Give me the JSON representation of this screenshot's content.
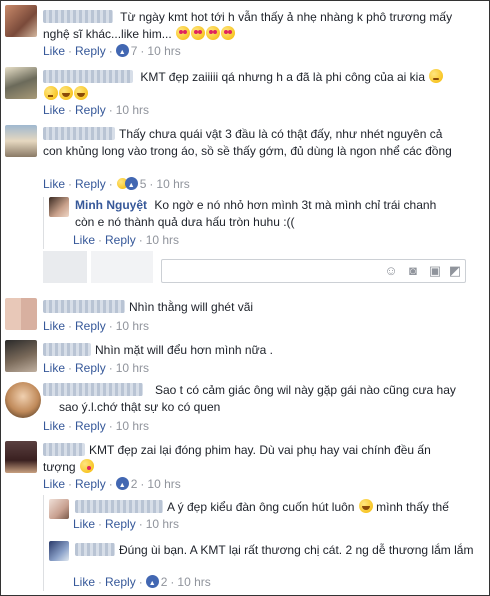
{
  "labels": {
    "like": "Like",
    "reply": "Reply",
    "dot": "·"
  },
  "comments": [
    {
      "text": "Từ ngày kmt hot tới h vẫn thấy ả nhẹ nhàng k phô trương mấy nghệ sĩ khác...like him...",
      "reactions": "like",
      "count": "7",
      "time": "10 hrs"
    },
    {
      "text": "KMT đẹp zaiiiii qá nhưng h a đã là phi công của ai kia",
      "reactions": "",
      "count": "",
      "time": "10 hrs"
    },
    {
      "text": "Thấy chưa quái vật 3 đầu là có thật đấy, như nhét nguyên cả con khủng long vào trong áo, sồ sề thấy gớm, đủ dùng là ngon nhể các đồng",
      "reactions": "haha-like",
      "count": "5",
      "time": "10 hrs"
    },
    {
      "name": "Minh Nguyệt",
      "text": "Ko ngờ e nó nhỏ hơn mình 3t mà mình chỉ trái chanh còn e nó thành quả dưa hấu tròn huhu :((",
      "reactions": "",
      "count": "",
      "time": "10 hrs"
    },
    {
      "text": "Nhìn thằng will ghét vãi",
      "reactions": "",
      "count": "",
      "time": "10 hrs"
    },
    {
      "text": "Nhìn mặt will đểu hơn mình nữa .",
      "reactions": "",
      "count": "",
      "time": "10 hrs"
    },
    {
      "text": "Sao t có cảm giác ông wil này gặp gái nào cũng cưa hay sao ý.l.chớ thật sự ko có quen",
      "reactions": "",
      "count": "",
      "time": "10 hrs"
    },
    {
      "text": "KMT đẹp zai lại đóng phim hay. Dù vai phụ hay vai chính đều ấn tượng",
      "reactions": "like",
      "count": "2",
      "time": "10 hrs"
    },
    {
      "text": "A ý đẹp kiểu đàn ông cuốn hút luôn",
      "text2": "mình thấy thế",
      "reactions": "",
      "count": "",
      "time": "10 hrs"
    },
    {
      "text": "Đúng ùi bạn. A KMT lại rất thương chị cát. 2 ng dễ thương lắm lắm",
      "reactions": "like",
      "count": "2",
      "time": "10 hrs"
    }
  ],
  "reply_box": {
    "icons": [
      "emoji-icon",
      "camera-icon",
      "gif-icon",
      "sticker-icon"
    ]
  },
  "colors": {
    "link": "#365899",
    "meta": "#90949c",
    "like": "#4267b2"
  }
}
